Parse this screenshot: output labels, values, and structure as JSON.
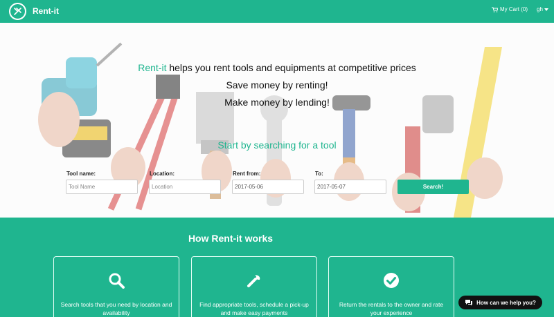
{
  "nav": {
    "brand": "Rent-it",
    "cart_label": "My Cart (0)",
    "user_label": "gh"
  },
  "hero": {
    "headline_accent": "Rent-it",
    "headline_rest": " helps you rent tools and equipments at competitive prices",
    "line2": "Save money by renting!",
    "line3": "Make money by lending!",
    "cta": "Start by searching for a tool"
  },
  "search": {
    "tool_label": "Tool name:",
    "tool_placeholder": "Tool Name",
    "location_label": "Location:",
    "location_placeholder": "Location",
    "from_label": "Rent from:",
    "from_value": "2017-05-06",
    "to_label": "To:",
    "to_value": "2017-05-07",
    "button": "Search!"
  },
  "how": {
    "title": "How Rent-it works",
    "cards": [
      {
        "icon": "search-icon",
        "text": "Search tools that you need by location and availability"
      },
      {
        "icon": "wrench-icon",
        "text": "Find appropriate tools, schedule a pick-up and make easy payments"
      },
      {
        "icon": "check-circle-icon",
        "text": "Return the rentals to the owner and rate your experience"
      }
    ]
  },
  "help": {
    "label": "How can we help you?"
  },
  "colors": {
    "accent": "#1fb58f",
    "dark": "#111111"
  }
}
